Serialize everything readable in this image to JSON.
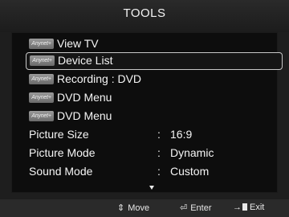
{
  "title": "TOOLS",
  "anynet_badge_text": "Anynet+",
  "menu_items": [
    {
      "label": "View TV"
    },
    {
      "label": "Device List"
    },
    {
      "label": "Recording : DVD"
    },
    {
      "label": "DVD Menu"
    },
    {
      "label": "DVD Menu"
    }
  ],
  "settings": [
    {
      "label": "Picture Size",
      "colon": ":",
      "value": "16:9"
    },
    {
      "label": "Picture Mode",
      "colon": ":",
      "value": "Dynamic"
    },
    {
      "label": "Sound Mode",
      "colon": ":",
      "value": "Custom"
    }
  ],
  "footer": {
    "move": {
      "icon": "⇕",
      "label": "Move"
    },
    "enter": {
      "icon": "⏎",
      "label": "Enter"
    },
    "exit": {
      "icon": "→",
      "label": "Exit"
    }
  },
  "colors": {
    "background": "#1e1e1e",
    "panel": "#0d0d0d",
    "text": "#f5f5f5",
    "selection_border": "#c8c8c8"
  }
}
